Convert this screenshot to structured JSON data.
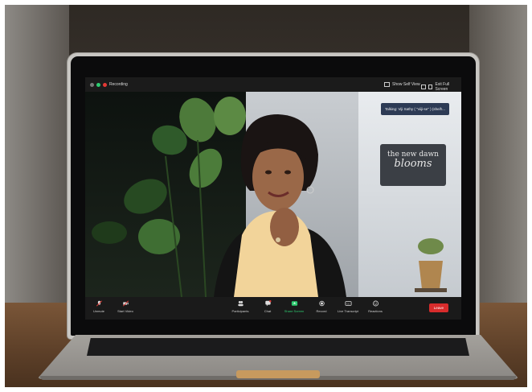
{
  "zoom": {
    "topbar": {
      "recording_label": "Recording",
      "self_view_label": "Show Self View",
      "fullscreen_label": "Exit Full Screen"
    },
    "talking_badge": "Talking: Viji Sathy ( \"viiji-se\" ) (she/h...",
    "toolbar": {
      "items": [
        {
          "label": "Unmute",
          "icon": "microphone-muted-icon"
        },
        {
          "label": "Start Video",
          "icon": "video-off-icon"
        },
        {
          "label": "Participants",
          "icon": "participants-icon"
        },
        {
          "label": "Chat",
          "icon": "chat-icon"
        },
        {
          "label": "Share Screen",
          "icon": "share-screen-icon"
        },
        {
          "label": "Record",
          "icon": "record-icon"
        },
        {
          "label": "Live Transcript",
          "icon": "cc-icon"
        },
        {
          "label": "Reactions",
          "icon": "smiley-icon"
        }
      ],
      "leave_label": "Leave"
    },
    "sign_text": [
      "the new dawn",
      "blooms"
    ],
    "colors": {
      "record_dot": "#e53935",
      "share_screen": "#2ecc71",
      "leave": "#d82c2c",
      "talking_badge": "#2d3b55"
    }
  }
}
